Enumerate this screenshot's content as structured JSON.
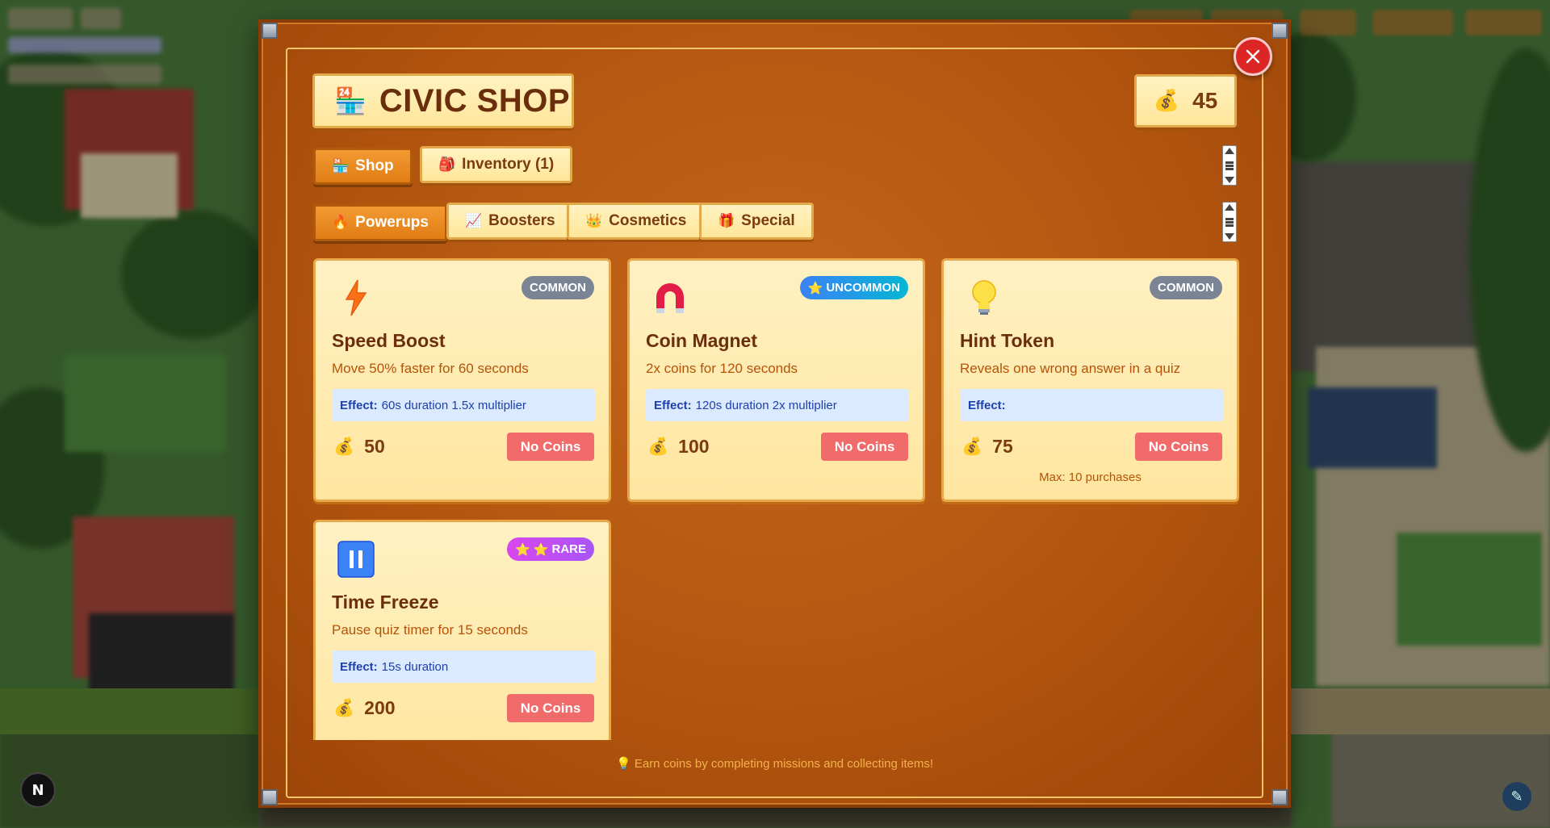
{
  "shop": {
    "title": "CIVIC SHOP",
    "title_icon": "convenience-store-icon",
    "coins": "45",
    "coin_icon": "money-bag-icon"
  },
  "tabs": [
    {
      "label": "Shop",
      "icon": "store-icon",
      "active": true
    },
    {
      "label": "Inventory (1)",
      "icon": "backpack-icon",
      "active": false
    }
  ],
  "categories": [
    {
      "label": "Powerups",
      "icon": "fire-icon",
      "active": true
    },
    {
      "label": "Boosters",
      "icon": "chart-icon",
      "active": false
    },
    {
      "label": "Cosmetics",
      "icon": "crown-icon",
      "active": false
    },
    {
      "label": "Special",
      "icon": "gift-icon",
      "active": false
    }
  ],
  "items": [
    {
      "name": "Speed Boost",
      "icon": "lightning-icon",
      "rarity": "COMMON",
      "description": "Move 50% faster for 60 seconds",
      "effect_label": "Effect:",
      "effect_value": "60s duration 1.5x multiplier",
      "price": "50",
      "button": "No Coins"
    },
    {
      "name": "Coin Magnet",
      "icon": "magnet-icon",
      "rarity": "UNCOMMON",
      "description": "2x coins for 120 seconds",
      "effect_label": "Effect:",
      "effect_value": "120s duration 2x multiplier",
      "price": "100",
      "button": "No Coins"
    },
    {
      "name": "Hint Token",
      "icon": "light-bulb-icon",
      "rarity": "COMMON",
      "description": "Reveals one wrong answer in a quiz",
      "effect_label": "Effect:",
      "effect_value": "",
      "price": "75",
      "button": "No Coins",
      "limit": "Max: 10 purchases"
    },
    {
      "name": "Time Freeze",
      "icon": "pause-icon",
      "rarity": "RARE",
      "description": "Pause quiz timer for 15 seconds",
      "effect_label": "Effect:",
      "effect_value": "15s duration",
      "price": "200",
      "button": "No Coins"
    }
  ],
  "footer_tip": "Earn coins by completing missions and collecting items!",
  "footer_icon": "light-bulb-icon",
  "colors": {
    "modal_bg": "#b2550f",
    "card_bg": "#ffe6a0",
    "common": "#7b8494",
    "uncommon": "#3b82f6",
    "rare": "#d946ef",
    "no_coins_button": "#f26b6b",
    "close_button": "#dc2626"
  }
}
